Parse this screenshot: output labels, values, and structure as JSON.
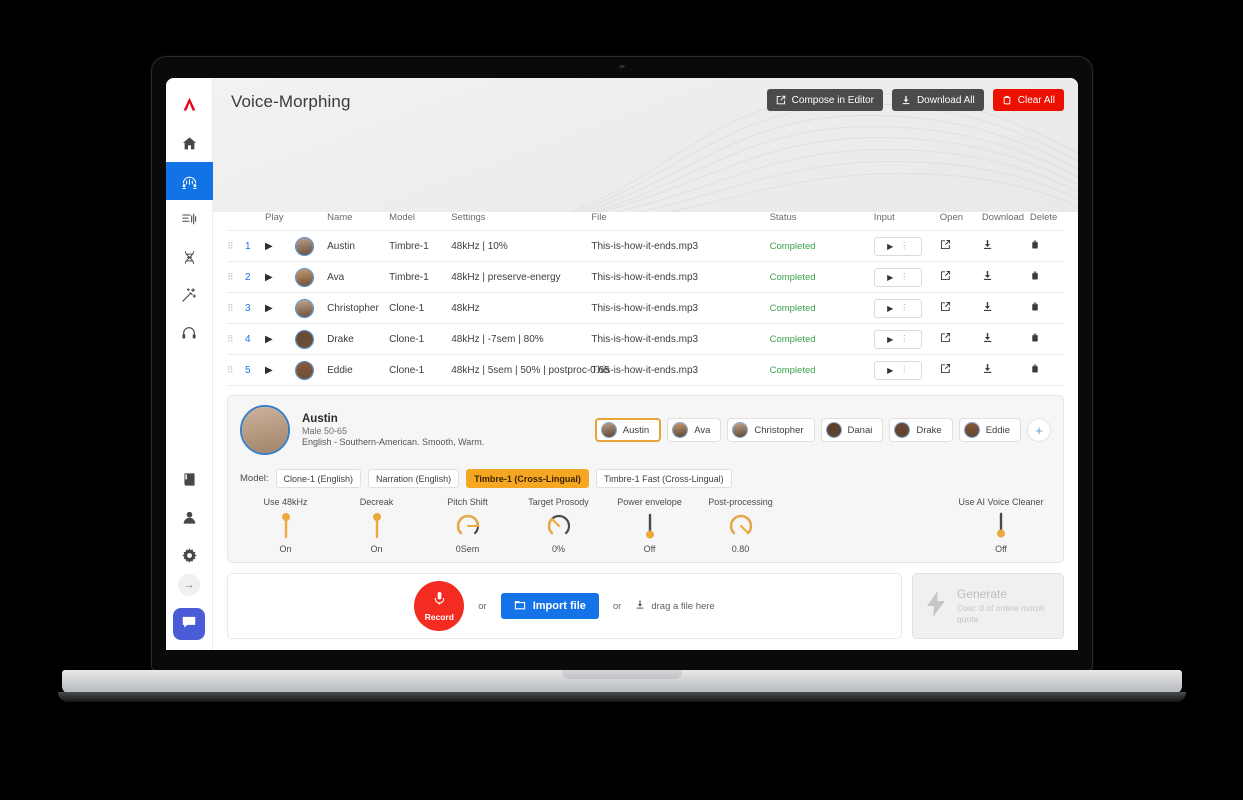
{
  "app": {
    "logo": "adobe-a-logo",
    "title": "Voice-Morphing"
  },
  "sidebar": {
    "items": [
      {
        "name": "home",
        "icon": "home-icon",
        "active": false
      },
      {
        "name": "voice-morphing",
        "icon": "voice-morph-icon",
        "active": true
      },
      {
        "name": "text-to-speech",
        "icon": "waveform-text-icon",
        "active": false
      },
      {
        "name": "voice-clone",
        "icon": "dna-icon",
        "active": false
      },
      {
        "name": "enhance",
        "icon": "magic-wand-icon",
        "active": false
      },
      {
        "name": "listen",
        "icon": "headphones-icon",
        "active": false
      },
      {
        "name": "library",
        "icon": "book-icon",
        "active": false
      },
      {
        "name": "account",
        "icon": "person-icon",
        "active": false
      },
      {
        "name": "settings",
        "icon": "gear-icon",
        "active": false
      }
    ],
    "collapse_icon": "arrow-right-icon",
    "chat_icon": "chat-bubble-icon"
  },
  "header": {
    "buttons": [
      {
        "label": "Compose in Editor",
        "icon": "external-edit-icon",
        "style": "dark"
      },
      {
        "label": "Download All",
        "icon": "download-icon",
        "style": "dark"
      },
      {
        "label": "Clear All",
        "icon": "clear-icon",
        "style": "red"
      }
    ]
  },
  "table": {
    "columns": [
      "",
      "",
      "Play",
      "",
      "Name",
      "Model",
      "Settings",
      "File",
      "Status",
      "Input",
      "Open",
      "Download",
      "Delete"
    ],
    "headers": {
      "play": "Play",
      "name": "Name",
      "model": "Model",
      "settings": "Settings",
      "file": "File",
      "status": "Status",
      "input": "Input",
      "open": "Open",
      "download": "Download",
      "delete": "Delete"
    },
    "rows": [
      {
        "index": "1",
        "name": "Austin",
        "model": "Timbre-1",
        "settings": "48kHz | 10%",
        "file": "This-is-how-it-ends.mp3",
        "status": "Completed",
        "avatar": "#b8a08c"
      },
      {
        "index": "2",
        "name": "Ava",
        "model": "Timbre-1",
        "settings": "48kHz | preserve-energy",
        "file": "This-is-how-it-ends.mp3",
        "status": "Completed",
        "avatar": "#c99a6e"
      },
      {
        "index": "3",
        "name": "Christopher",
        "model": "Clone-1",
        "settings": "48kHz",
        "file": "This-is-how-it-ends.mp3",
        "status": "Completed",
        "avatar": "#c4a68e"
      },
      {
        "index": "4",
        "name": "Drake",
        "model": "Clone-1",
        "settings": "48kHz | -7sem | 80%",
        "file": "This-is-how-it-ends.mp3",
        "status": "Completed",
        "avatar": "#6b4a33"
      },
      {
        "index": "5",
        "name": "Eddie",
        "model": "Clone-1",
        "settings": "48kHz | 5sem | 50% | postproc-0.65",
        "file": "This-is-how-it-ends.mp3",
        "status": "Completed",
        "avatar": "#8a5a3c"
      }
    ]
  },
  "voice": {
    "selected": {
      "name": "Austin",
      "gender_age": "Male 50-65",
      "description": "English - Southern-American. Smooth, Warm."
    },
    "chips": [
      {
        "label": "Austin",
        "selected": true,
        "avatar": "#b8a08c"
      },
      {
        "label": "Ava",
        "selected": false,
        "avatar": "#c99a6e"
      },
      {
        "label": "Christopher",
        "selected": false,
        "avatar": "#c4a68e"
      },
      {
        "label": "Danai",
        "selected": false,
        "avatar": "#5e3d29"
      },
      {
        "label": "Drake",
        "selected": false,
        "avatar": "#6b4a33"
      },
      {
        "label": "Eddie",
        "selected": false,
        "avatar": "#8a5a3c"
      }
    ],
    "add_label": "+"
  },
  "model_selector": {
    "label": "Model:",
    "tabs": [
      {
        "label": "Clone-1 (English)",
        "active": false
      },
      {
        "label": "Narration (English)",
        "active": false
      },
      {
        "label": "Timbre-1 (Cross-Lingual)",
        "active": true
      },
      {
        "label": "Timbre-1 Fast (Cross-Lingual)",
        "active": false
      }
    ],
    "active_color": "#f5a623"
  },
  "controls": [
    {
      "label": "Use 48kHz",
      "value": "On",
      "type": "toggle",
      "state": "on"
    },
    {
      "label": "Decreak",
      "value": "On",
      "type": "toggle",
      "state": "on"
    },
    {
      "label": "Pitch Shift",
      "value": "0Sem",
      "type": "knob",
      "angle": 0
    },
    {
      "label": "Target Prosody",
      "value": "0%",
      "type": "knob",
      "angle": -135
    },
    {
      "label": "Power envelope",
      "value": "Off",
      "type": "toggle",
      "state": "off"
    },
    {
      "label": "Post-processing",
      "value": "0.80",
      "type": "knob",
      "angle": 110
    }
  ],
  "cleaner": {
    "label": "Use AI Voice Cleaner",
    "value": "Off",
    "state": "off"
  },
  "upload": {
    "record_label": "Record",
    "record_icon": "microphone-icon",
    "or_1": "or",
    "import_label": "Import file",
    "import_icon": "folder-icon",
    "or_2": "or",
    "drag_icon": "download-icon",
    "drag_label": "drag a file here"
  },
  "generate": {
    "icon": "lightning-icon",
    "title": "Generate",
    "subtitle": "Cost: 0 of online morph quota"
  },
  "colors": {
    "accent_blue": "#1473e6",
    "accent_orange": "#f5a623",
    "danger_red": "#eb1000",
    "status_green": "#3aa34c",
    "logo_red": "#e3051b"
  }
}
